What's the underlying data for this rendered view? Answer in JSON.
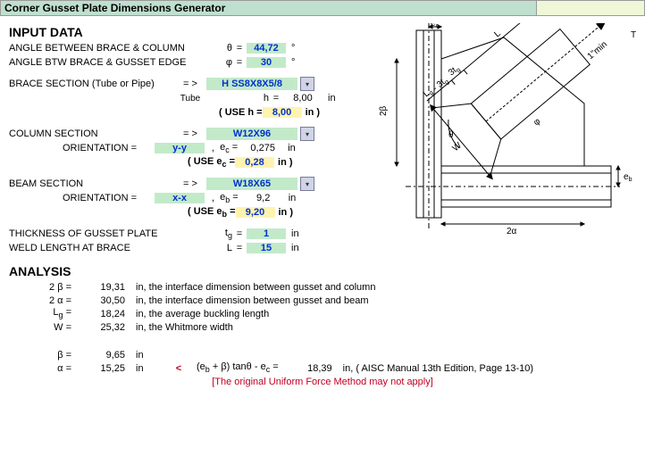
{
  "title": "Corner Gusset Plate Dimensions Generator",
  "headings": {
    "input": "INPUT DATA",
    "analysis": "ANALYSIS"
  },
  "theta": {
    "label": "ANGLE BETWEEN BRACE & COLUMN",
    "sym": "θ",
    "val": "44,72",
    "unit": "°"
  },
  "phi": {
    "label": "ANGLE BTW BRACE & GUSSET EDGE",
    "sym": "φ",
    "val": "30",
    "unit": "°"
  },
  "brace": {
    "label": "BRACE SECTION (Tube or Pipe)",
    "arrow": "= >",
    "sel": "H SS8X8X5/8",
    "sub": "Tube",
    "h_sym": "h",
    "h_val": "8,00",
    "h_unit": "in",
    "use": "( USE  h =",
    "use_val": "8,00",
    "use_unit": "in )"
  },
  "column": {
    "label": "COLUMN SECTION",
    "arrow": "= >",
    "sel": "W12X96",
    "orient_lab": "ORIENTATION =",
    "orient": "y-y",
    "ec_sym": "e",
    "ec_sub": "c",
    "ec_val": "0,275",
    "ec_unit": "in",
    "use": "( USE  e",
    "use_val": "0,28",
    "use_unit": "in )"
  },
  "beam": {
    "label": "BEAM SECTION",
    "arrow": "= >",
    "sel": "W18X65",
    "orient_lab": "ORIENTATION =",
    "orient": "x-x",
    "eb_sym": "e",
    "eb_sub": "b",
    "eb_val": "9,2",
    "eb_unit": "in",
    "use": "( USE  e",
    "use_val": "9,20",
    "use_unit": "in )"
  },
  "tg": {
    "label": "THICKNESS OF GUSSET PLATE",
    "sym": "t",
    "sub": "g",
    "val": "1",
    "unit": "in"
  },
  "L": {
    "label": "WELD LENGTH AT BRACE",
    "sym": "L",
    "val": "15",
    "unit": "in"
  },
  "analysis": {
    "r1": {
      "s": "2 β =",
      "v": "19,31",
      "d": "in, the interface dimension between gusset and column"
    },
    "r2": {
      "s": "2 α =",
      "v": "30,50",
      "d": "in, the interface dimension between gusset and beam"
    },
    "r3": {
      "s": "L",
      "sub": "g",
      "eq": " =",
      "v": "18,24",
      "d": "in, the average buckling length"
    },
    "r4": {
      "s": "W =",
      "v": "25,32",
      "d": "in, the Whitmore width"
    },
    "r5": {
      "s": "β =",
      "v": "9,65",
      "d": "in"
    },
    "r6": {
      "s": "α =",
      "v": "15,25",
      "d": "in",
      "lt": "<",
      "expr": "(e",
      "sub": "b",
      "expr2": " + β) tanθ - e",
      "sub2": "c",
      "expr3": " =",
      "rv": "18,39",
      "ref": "in, ( AISC Manual 13th Edition, Page 13-10)"
    }
  },
  "warn": "[The original Uniform Force Method may not apply]",
  "diagram": {
    "ec": "e",
    "ec_sub": "c",
    "eb": "e",
    "eb_sub": "b",
    "two_a": "2α",
    "two_b": "2β",
    "theta": "θ",
    "phi": "φ",
    "tg": "3t",
    "tg_sub": "g",
    "L": "L",
    "lg": "L",
    "lg_sub": "g",
    "lg2": " - 3t",
    "W": "W",
    "T": "T",
    "tmin": "1\"min"
  }
}
